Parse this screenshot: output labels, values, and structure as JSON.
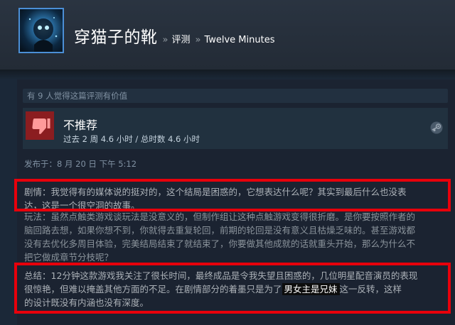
{
  "header": {
    "persona_name": "穿猫子的靴",
    "breadcrumb": [
      {
        "label": "评测"
      },
      {
        "label": "Twelve Minutes"
      }
    ],
    "separator": "»"
  },
  "review": {
    "helpful_text": "有 9 人觉得这篇评测有价值",
    "verdict": "不推荐",
    "hours": "过去 2 周 4.6 小时 / 总时数 4.6 小时",
    "posted": "发布于：8 月 20 日 下午 5:12",
    "paragraphs": {
      "p1": [
        "剧情：我觉得有的媒体说的挺对的，这个结局是困惑的，它想表达什么呢？其实到最后什么也没表",
        "达，这是一个很空洞的故事。"
      ],
      "p2": [
        "玩法：虽然点触类游戏谈玩法是没意义的，但制作组让这种点触游戏变得很折磨。是你要按照作者的",
        "脑回路去想，如果你想不到，你就得去重复轮回，前期的轮回是没有意义且枯燥乏味的。甚至游戏都",
        "没有去优化多周目体验，完美结局结束了就结束了，你要做其他成就的话就重头开始，那么为什么不",
        "把它做成章节分枝呢？"
      ],
      "p3_line1": "总结：12分钟这款游戏我关注了很长时间，最终成品是令我失望且困惑的，几位明星配音演员的表现",
      "p3_line2": "很惊艳，但难以掩盖其他方面的不足。在剧情部分的着墨只是为了",
      "p3_highlight": "男女主是兄妹",
      "p3_line2_end": "这一反转，这样",
      "p3_line3": "的设计既没有内涵也没有深度。"
    }
  },
  "colors": {
    "background": "#1b2838",
    "annotation_red": "#e8000b",
    "thumb_red": "#8b1d20"
  },
  "icons": {
    "thumb": "thumbs-down-icon",
    "platform": "steam-icon"
  }
}
